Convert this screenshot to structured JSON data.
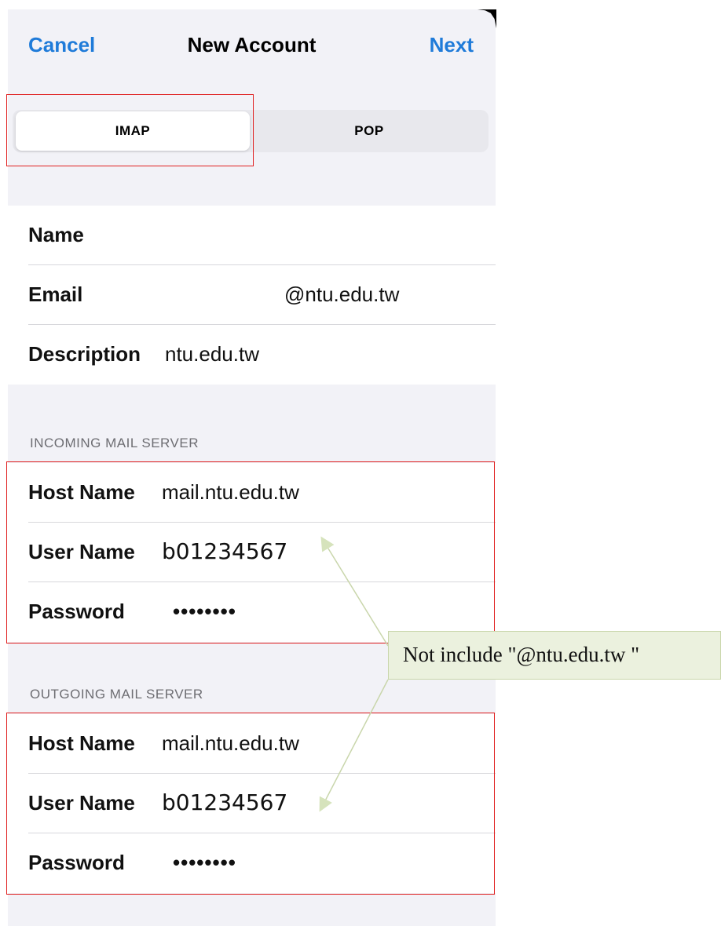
{
  "nav": {
    "cancel_label": "Cancel",
    "title": "New Account",
    "next_label": "Next"
  },
  "protocol": {
    "options": [
      "IMAP",
      "POP"
    ],
    "selected": "IMAP"
  },
  "account": {
    "name_label": "Name",
    "name_value": "",
    "email_label": "Email",
    "email_value": "@ntu.edu.tw",
    "description_label": "Description",
    "description_value": "ntu.edu.tw"
  },
  "incoming": {
    "header": "INCOMING MAIL SERVER",
    "host_label": "Host Name",
    "host_value": "mail.ntu.edu.tw",
    "user_label": "User Name",
    "user_value": "b01234567",
    "password_label": "Password",
    "password_value": "••••••••"
  },
  "outgoing": {
    "header": "OUTGOING MAIL SERVER",
    "host_label": "Host Name",
    "host_value": "mail.ntu.edu.tw",
    "user_label": "User Name",
    "user_value": "b01234567",
    "password_label": "Password",
    "password_value": "••••••••"
  },
  "annotation": {
    "note": "Not include \"@ntu.edu.tw \""
  },
  "colors": {
    "accent": "#1f7bd9",
    "highlight_box": "#e02020",
    "callout_bg": "#ebf1de"
  }
}
